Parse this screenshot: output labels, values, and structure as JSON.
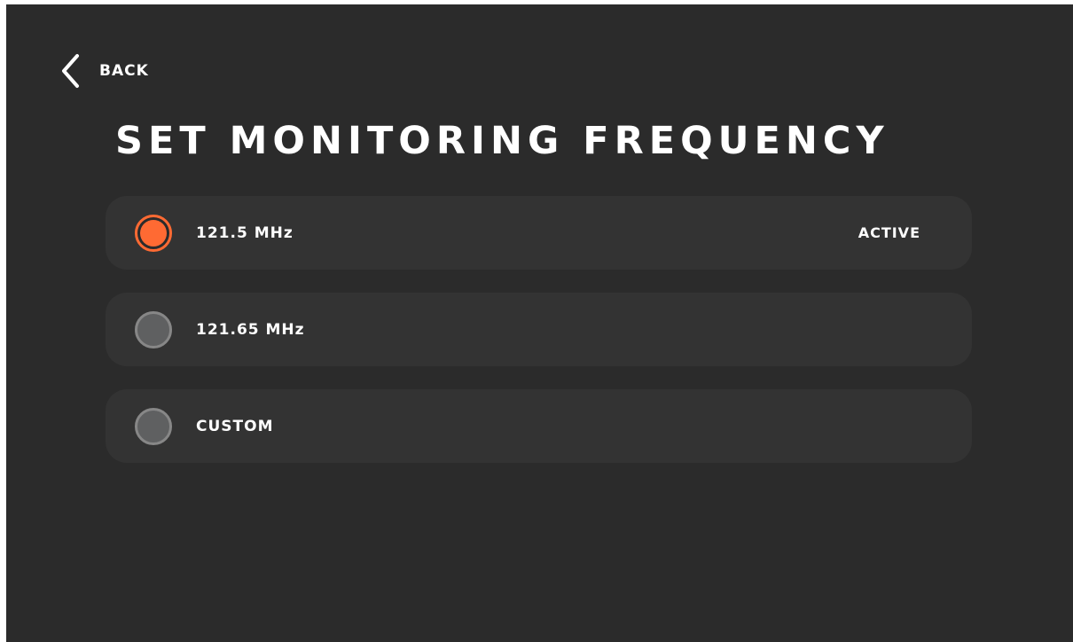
{
  "header": {
    "back_label": "BACK",
    "title": "SET MONITORING FREQUENCY"
  },
  "options": [
    {
      "label": "121.5 MHz",
      "status": "ACTIVE",
      "selected": true
    },
    {
      "label": "121.65 MHz",
      "status": "",
      "selected": false
    },
    {
      "label": "CUSTOM",
      "status": "",
      "selected": false
    }
  ],
  "colors": {
    "background": "#2b2b2b",
    "card": "#333333",
    "accent": "#ff6a33",
    "radio_inactive_fill": "#5f6061",
    "radio_inactive_border": "#878787",
    "text": "#ffffff"
  },
  "icons": {
    "back": "chevron-left-icon"
  }
}
